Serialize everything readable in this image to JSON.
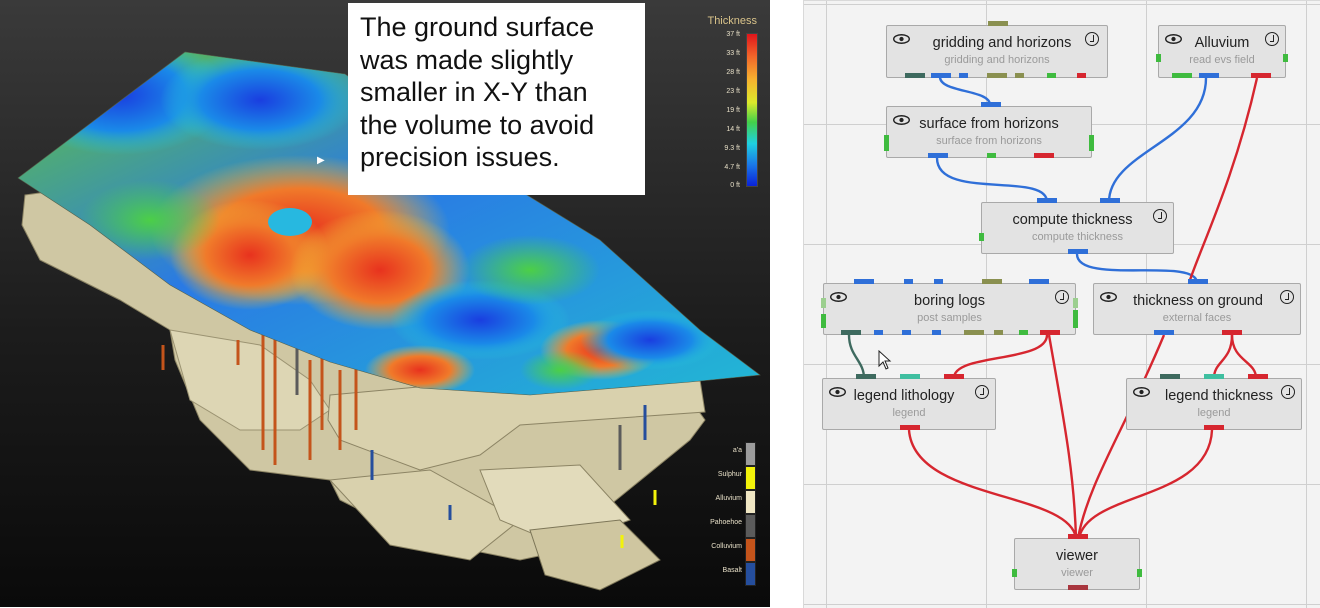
{
  "annotation": {
    "text": "The ground surface\nwas made slightly\nsmaller in X-Y than\nthe volume to avoid\nprecision issues."
  },
  "thickness_legend": {
    "title": "Thickness",
    "ticks": [
      "37 ft",
      "33 ft",
      "28 ft",
      "23 ft",
      "19 ft",
      "14 ft",
      "9.3 ft",
      "4.7 ft",
      "0 ft"
    ]
  },
  "lithology_legend": {
    "items": [
      {
        "label": "a'a",
        "color": "#9c9c9c"
      },
      {
        "label": "Sulphur",
        "color": "#f2f20a"
      },
      {
        "label": "Alluvium",
        "color": "#efe6c3"
      },
      {
        "label": "Pahoehoe",
        "color": "#5b5b5b"
      },
      {
        "label": "Colluvium",
        "color": "#c4541b"
      },
      {
        "label": "Basalt",
        "color": "#254e9d"
      }
    ]
  },
  "colors": {
    "wire_blue": "#2f6fd8",
    "wire_red": "#d6262f",
    "wire_teal": "#3e6a5f",
    "port_green": "#3fbb3f"
  },
  "nodes": {
    "gridding": {
      "title": "gridding and horizons",
      "subtitle": "gridding and horizons"
    },
    "alluvium": {
      "title": "Alluvium",
      "subtitle": "read evs field"
    },
    "surface": {
      "title": "surface from horizons",
      "subtitle": "surface from horizons"
    },
    "compute": {
      "title": "compute thickness",
      "subtitle": "compute thickness"
    },
    "boring": {
      "title": "boring logs",
      "subtitle": "post samples"
    },
    "ground": {
      "title": "thickness on ground",
      "subtitle": "external faces"
    },
    "leglith": {
      "title": "legend lithology",
      "subtitle": "legend"
    },
    "legthick": {
      "title": "legend thickness",
      "subtitle": "legend"
    },
    "viewer": {
      "title": "viewer",
      "subtitle": "viewer"
    }
  }
}
